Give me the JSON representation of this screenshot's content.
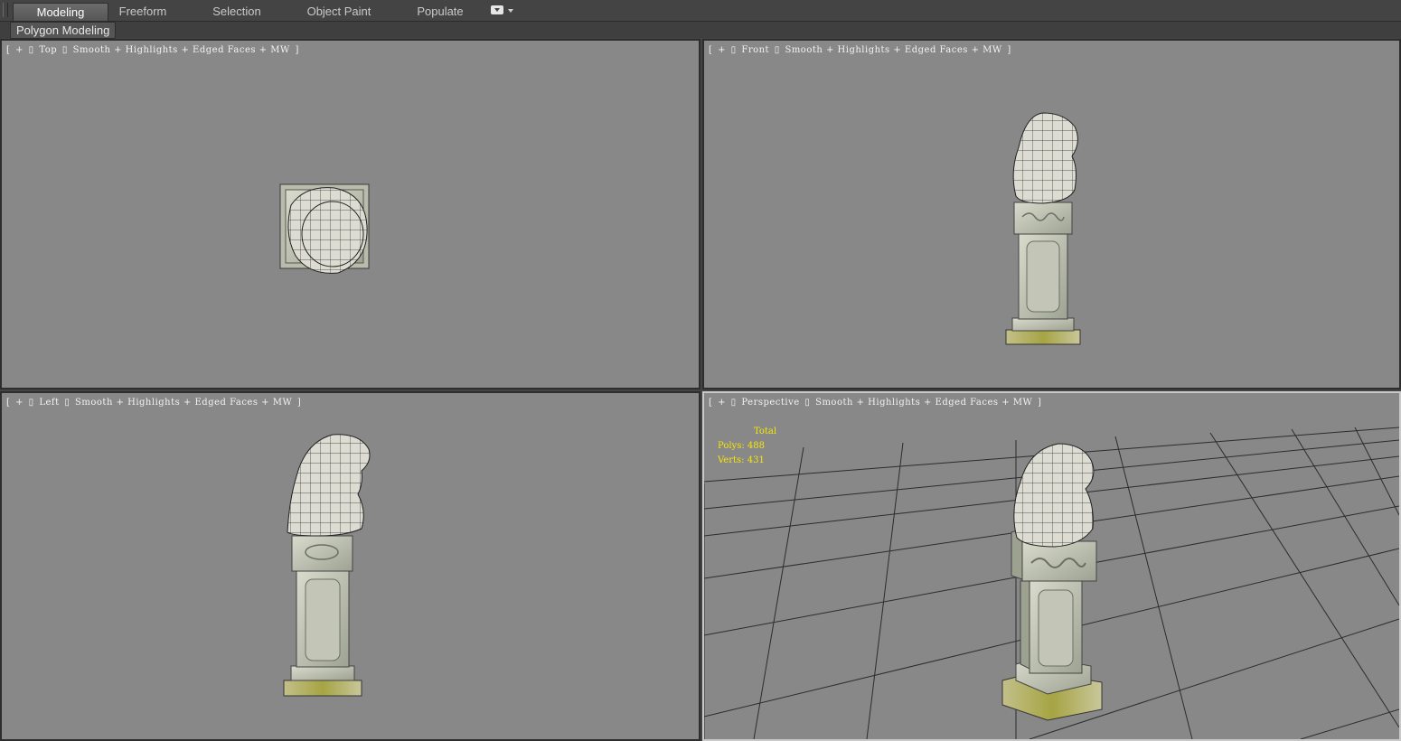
{
  "ribbon": {
    "tabs": [
      {
        "label": "Modeling",
        "active": true
      },
      {
        "label": "Freeform"
      },
      {
        "label": "Selection"
      },
      {
        "label": "Object Paint"
      },
      {
        "label": "Populate"
      }
    ],
    "panel_label": "Polygon Modeling"
  },
  "viewports": {
    "top": {
      "bracket_open": "[",
      "plus": "+",
      "sep1": "▯",
      "view": "Top",
      "sep2": "▯",
      "mode": "Smooth + Highlights + Edged Faces + MW",
      "bracket_close": "]"
    },
    "front": {
      "bracket_open": "[",
      "plus": "+",
      "sep1": "▯",
      "view": "Front",
      "sep2": "▯",
      "mode": "Smooth + Highlights + Edged Faces + MW",
      "bracket_close": "]"
    },
    "left": {
      "bracket_open": "[",
      "plus": "+",
      "sep1": "▯",
      "view": "Left",
      "sep2": "▯",
      "mode": "Smooth + Highlights + Edged Faces + MW",
      "bracket_close": "]"
    },
    "perspective": {
      "bracket_open": "[",
      "plus": "+",
      "sep1": "▯",
      "view": "Perspective",
      "sep2": "▯",
      "mode": "Smooth + Highlights + Edged Faces + MW",
      "bracket_close": "]"
    }
  },
  "stats": {
    "title": "Total",
    "polys_label": "Polys:",
    "polys": "488",
    "verts_label": "Verts:",
    "verts": "431"
  },
  "colors": {
    "viewport_bg": "#888888",
    "ui_bg": "#444444",
    "active_border": "#c9c9c9",
    "stats_text": "#f4e50e",
    "stone": "#cfd1c2",
    "moss": "#a8a64a"
  },
  "icons": [
    "ribbon-options-icon",
    "dropdown-caret-icon"
  ]
}
